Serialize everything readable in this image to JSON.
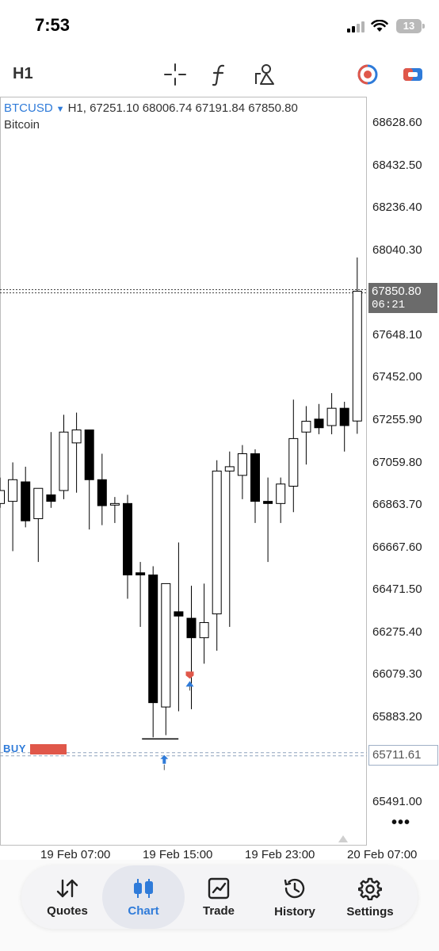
{
  "status": {
    "time": "7:53",
    "battery": "13"
  },
  "toolbar": {
    "timeframe": "H1",
    "icons": [
      "crosshair-icon",
      "indicator-f-icon",
      "objects-icon",
      "one-click-trading-icon",
      "trade-icon"
    ]
  },
  "chart": {
    "symbol": "BTCUSD",
    "header": "H1, 67251.10 68006.74 67191.84 67850.80",
    "description": "Bitcoin",
    "current_price": "67850.80",
    "countdown": "06:21",
    "buy_label": "BUY",
    "buy_price": "65711.61",
    "price_axis": [
      "68628.60",
      "68432.50",
      "68236.40",
      "68040.30",
      "67648.10",
      "67452.00",
      "67255.90",
      "67059.80",
      "66863.70",
      "66667.60",
      "66471.50",
      "66275.40",
      "66079.30",
      "65883.20",
      "65491.00"
    ],
    "time_axis": [
      "19 Feb 07:00",
      "19 Feb 15:00",
      "19 Feb 23:00",
      "20 Feb 07:00"
    ],
    "more": "•••",
    "colors": {
      "bull": "#ffffff",
      "bear": "#000000",
      "accent": "#2f7bd9",
      "sell": "#e0574a"
    }
  },
  "chart_data": {
    "type": "candlestick",
    "title": "BTCUSD",
    "ylim": [
      65400,
      68780
    ],
    "series": [
      {
        "o": 66870,
        "h": 66990,
        "l": 66850,
        "c": 66930
      },
      {
        "o": 66880,
        "h": 67060,
        "l": 66650,
        "c": 66980
      },
      {
        "o": 66970,
        "h": 67040,
        "l": 66760,
        "c": 66790
      },
      {
        "o": 66800,
        "h": 66940,
        "l": 66600,
        "c": 66940
      },
      {
        "o": 66910,
        "h": 67200,
        "l": 66850,
        "c": 66880
      },
      {
        "o": 66930,
        "h": 67280,
        "l": 66890,
        "c": 67200
      },
      {
        "o": 67150,
        "h": 67290,
        "l": 66920,
        "c": 67210
      },
      {
        "o": 67210,
        "h": 67210,
        "l": 66750,
        "c": 66980
      },
      {
        "o": 66980,
        "h": 67100,
        "l": 66770,
        "c": 66860
      },
      {
        "o": 66870,
        "h": 66900,
        "l": 66780,
        "c": 66870
      },
      {
        "o": 66870,
        "h": 66910,
        "l": 66430,
        "c": 66540
      },
      {
        "o": 66550,
        "h": 66600,
        "l": 66300,
        "c": 66540
      },
      {
        "o": 66540,
        "h": 66580,
        "l": 65790,
        "c": 65950
      },
      {
        "o": 65930,
        "h": 66320,
        "l": 65800,
        "c": 66500
      },
      {
        "o": 66370,
        "h": 66690,
        "l": 65910,
        "c": 66350
      },
      {
        "o": 66340,
        "h": 66490,
        "l": 65920,
        "c": 66250
      },
      {
        "o": 66250,
        "h": 66500,
        "l": 66130,
        "c": 66320
      },
      {
        "o": 66360,
        "h": 67070,
        "l": 66190,
        "c": 67020
      },
      {
        "o": 67020,
        "h": 67110,
        "l": 66300,
        "c": 67040
      },
      {
        "o": 67000,
        "h": 67140,
        "l": 66890,
        "c": 67100
      },
      {
        "o": 67100,
        "h": 67120,
        "l": 66780,
        "c": 66880
      },
      {
        "o": 66880,
        "h": 66990,
        "l": 66600,
        "c": 66870
      },
      {
        "o": 66870,
        "h": 66990,
        "l": 66780,
        "c": 66960
      },
      {
        "o": 66950,
        "h": 67350,
        "l": 66830,
        "c": 67170
      },
      {
        "o": 67200,
        "h": 67320,
        "l": 67050,
        "c": 67250
      },
      {
        "o": 67260,
        "h": 67330,
        "l": 67190,
        "c": 67220
      },
      {
        "o": 67230,
        "h": 67380,
        "l": 67190,
        "c": 67310
      },
      {
        "o": 67310,
        "h": 67340,
        "l": 67110,
        "c": 67230
      },
      {
        "o": 67251.1,
        "h": 68006.74,
        "l": 67191.84,
        "c": 67850.8
      }
    ],
    "current_price": 67850.8,
    "buy_level": 65711.61
  },
  "tabs": [
    {
      "label": "Quotes"
    },
    {
      "label": "Chart"
    },
    {
      "label": "Trade"
    },
    {
      "label": "History"
    },
    {
      "label": "Settings"
    }
  ]
}
